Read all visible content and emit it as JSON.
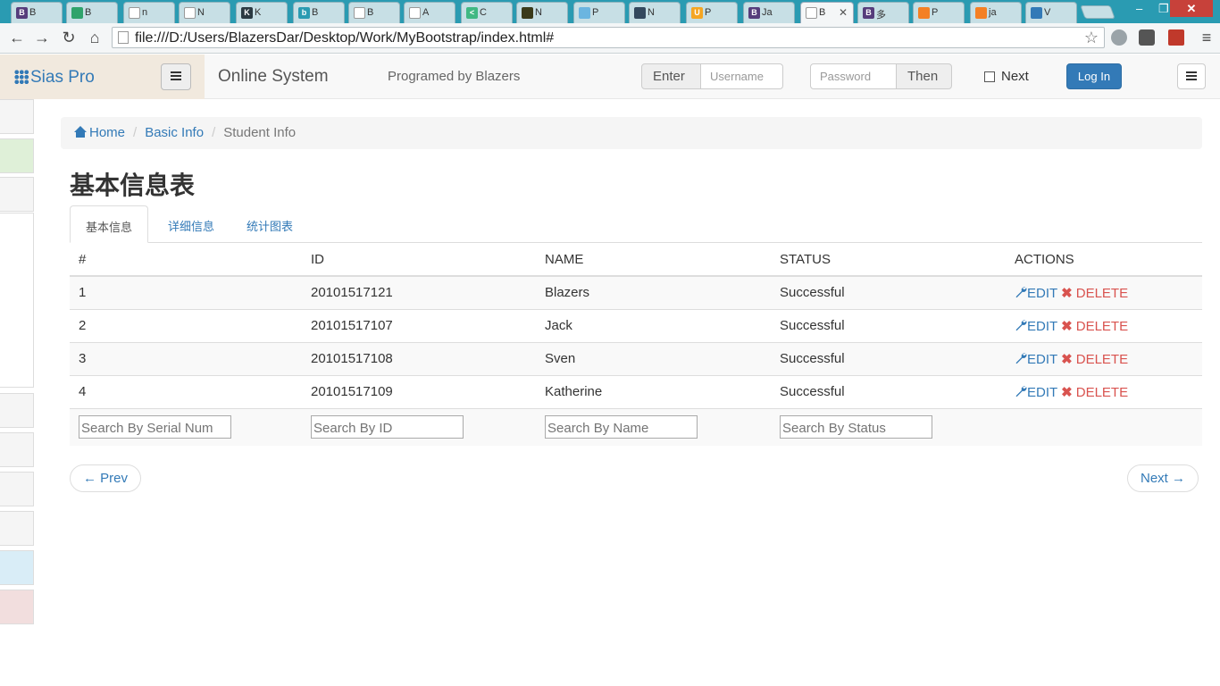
{
  "browser": {
    "tabs": [
      {
        "label": "B",
        "fav": "B",
        "color": "#563d7c"
      },
      {
        "label": "B",
        "fav": "",
        "color": "#2fa36b"
      },
      {
        "label": "n",
        "fav": "",
        "color": "#ffffff"
      },
      {
        "label": "N",
        "fav": "",
        "color": "#ffffff"
      },
      {
        "label": "K",
        "fav": "K",
        "color": "#2b3a42"
      },
      {
        "label": "B",
        "fav": "b",
        "color": "#2a9bb2"
      },
      {
        "label": "B",
        "fav": "",
        "color": "#ffffff"
      },
      {
        "label": "A",
        "fav": "",
        "color": "#ffffff"
      },
      {
        "label": "C",
        "fav": "<",
        "color": "#41b883"
      },
      {
        "label": "N",
        "fav": "",
        "color": "#3a3a1a"
      },
      {
        "label": "P",
        "fav": "",
        "color": "#6bb5e0"
      },
      {
        "label": "N",
        "fav": "",
        "color": "#34495e"
      },
      {
        "label": "P",
        "fav": "U",
        "color": "#f5a623"
      },
      {
        "label": "Ja",
        "fav": "B",
        "color": "#563d7c"
      },
      {
        "label": "B",
        "fav": "",
        "color": "#ffffff"
      },
      {
        "label": "多",
        "fav": "B",
        "color": "#563d7c"
      },
      {
        "label": "P",
        "fav": "",
        "color": "#f48024"
      },
      {
        "label": "ja",
        "fav": "",
        "color": "#f48024"
      },
      {
        "label": "V",
        "fav": "",
        "color": "#337ab7"
      }
    ],
    "active_tab_close": "✕",
    "url": "file:///D:/Users/BlazersDar/Desktop/Work/MyBootstrap/index.html#"
  },
  "navbar": {
    "brand": "Sias Pro",
    "title": "Online System",
    "subtitle": "Programed by Blazers",
    "enter_label": "Enter",
    "username_placeholder": "Username",
    "password_placeholder": "Password",
    "then_label": "Then",
    "next_checkbox_label": "Next",
    "login_label": "Log In"
  },
  "breadcrumb": {
    "home": "Home",
    "basic": "Basic Info",
    "current": "Student Info",
    "separator": "/"
  },
  "page": {
    "heading": "基本信息表"
  },
  "tabs": [
    "基本信息",
    "详细信息",
    "统计图表"
  ],
  "table": {
    "headers": [
      "#",
      "ID",
      "NAME",
      "STATUS",
      "ACTIONS"
    ],
    "rows": [
      [
        "1",
        "20101517121",
        "Blazers",
        "Successful"
      ],
      [
        "2",
        "20101517107",
        "Jack",
        "Successful"
      ],
      [
        "3",
        "20101517108",
        "Sven",
        "Successful"
      ],
      [
        "4",
        "20101517109",
        "Katherine",
        "Successful"
      ]
    ],
    "edit_label": "EDIT",
    "delete_label": "DELETE",
    "search_placeholders": [
      "Search By Serial Num",
      "Search By ID",
      "Search By Name",
      "Search By Status"
    ]
  },
  "pager": {
    "prev": "← Prev",
    "next": "Next →"
  },
  "colors": {
    "primary": "#337ab7",
    "danger": "#d9534f",
    "tabstrip": "#2a9bb2"
  }
}
